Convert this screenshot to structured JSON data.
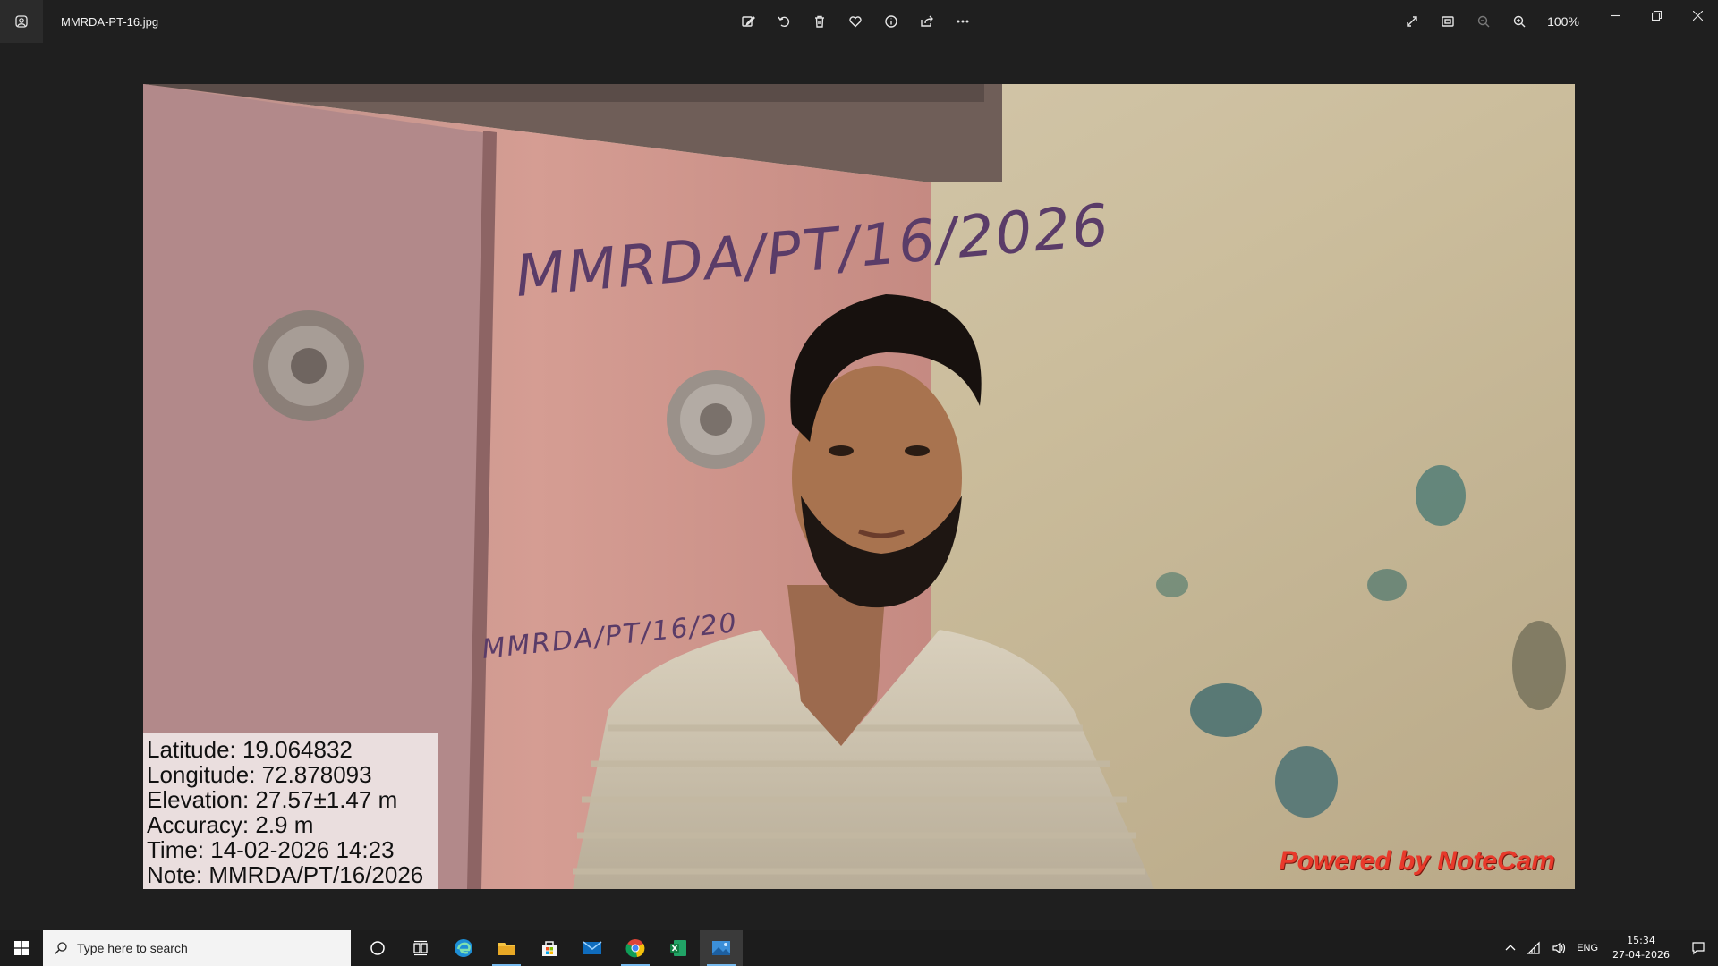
{
  "window": {
    "filename": "MMRDA-PT-16.jpg",
    "zoom": "100%"
  },
  "toolbar": {
    "buttons": [
      "edit-image",
      "rotate",
      "delete",
      "favorite",
      "info",
      "share",
      "more"
    ]
  },
  "photo": {
    "door_text_top": "MMRDA/PT/16/2026",
    "door_text_bottom": "MMRDA/PT/16/20",
    "info": {
      "latitude": "Latitude: 19.064832",
      "longitude": "Longitude: 72.878093",
      "elevation": "Elevation: 27.57±1.47 m",
      "accuracy": "Accuracy: 2.9 m",
      "time": "Time: 14-02-2026 14:23",
      "note": "Note: MMRDA/PT/16/2026"
    },
    "watermark": "Powered by NoteCam"
  },
  "taskbar": {
    "search_placeholder": "Type here to search",
    "language": "ENG",
    "time": "15:34",
    "date": "27-04-2026"
  }
}
